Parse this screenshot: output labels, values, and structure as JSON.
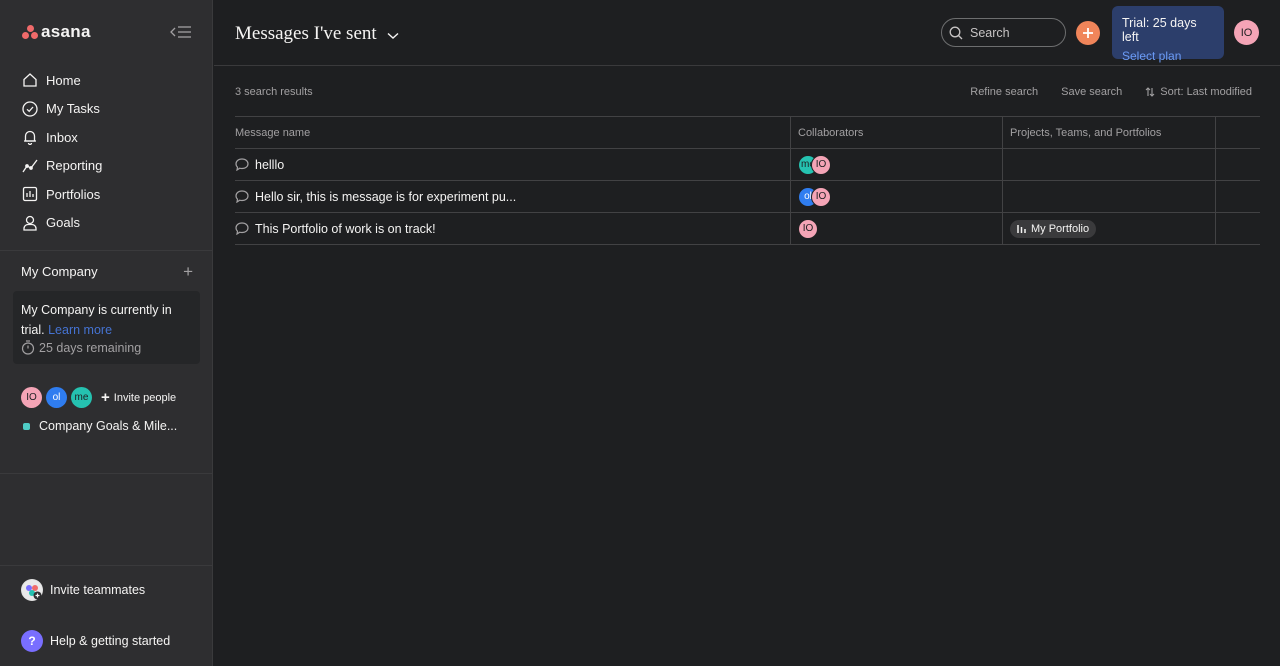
{
  "brand": {
    "name": "asana",
    "logo_color": "#f06a6a"
  },
  "sidebar": {
    "nav": [
      {
        "label": "Home",
        "icon": "home-icon"
      },
      {
        "label": "My Tasks",
        "icon": "check-circle-icon"
      },
      {
        "label": "Inbox",
        "icon": "bell-icon"
      },
      {
        "label": "Reporting",
        "icon": "line-chart-icon"
      },
      {
        "label": "Portfolios",
        "icon": "portfolio-icon"
      },
      {
        "label": "Goals",
        "icon": "person-icon"
      }
    ],
    "company": {
      "name": "My Company",
      "trial_text": "My Company is currently in trial.",
      "learn_more": "Learn more",
      "days_remaining": "25 days remaining"
    },
    "members": [
      "IO",
      "ol",
      "me"
    ],
    "invite_people": "Invite people",
    "goal_project": {
      "label": "Company Goals & Mile...",
      "color": "#4ecbc4"
    },
    "invite_teammates": "Invite teammates",
    "help": "Help & getting started"
  },
  "header": {
    "title": "Messages I've sent",
    "search_placeholder": "Search",
    "trial_label": "Trial: 25 days left",
    "select_plan": "Select plan",
    "user_initials": "IO"
  },
  "results": {
    "count_text": "3 search results",
    "refine": "Refine search",
    "save": "Save search",
    "sort": "Sort: Last modified"
  },
  "table": {
    "columns": [
      "Message name",
      "Collaborators",
      "Projects, Teams, and Portfolios"
    ],
    "rows": [
      {
        "message": "helllo",
        "collaborators": [
          "me",
          "IO"
        ],
        "portfolio": ""
      },
      {
        "message": "Hello sir, this is message is for experiment pu...",
        "collaborators": [
          "ol",
          "IO"
        ],
        "portfolio": ""
      },
      {
        "message": "This Portfolio of work is on track!",
        "collaborators": [
          "IO"
        ],
        "portfolio": "My Portfolio"
      }
    ]
  },
  "colors": {
    "bg": "#1e1f21",
    "sidebar": "#2e2e30",
    "accent_link": "#4573d2",
    "avatar_io": "#f4a4b6",
    "avatar_ol": "#2f7df0",
    "avatar_me": "#25c2b0",
    "add_button": "#f0855a",
    "trial_card": "#2c3e6b"
  }
}
